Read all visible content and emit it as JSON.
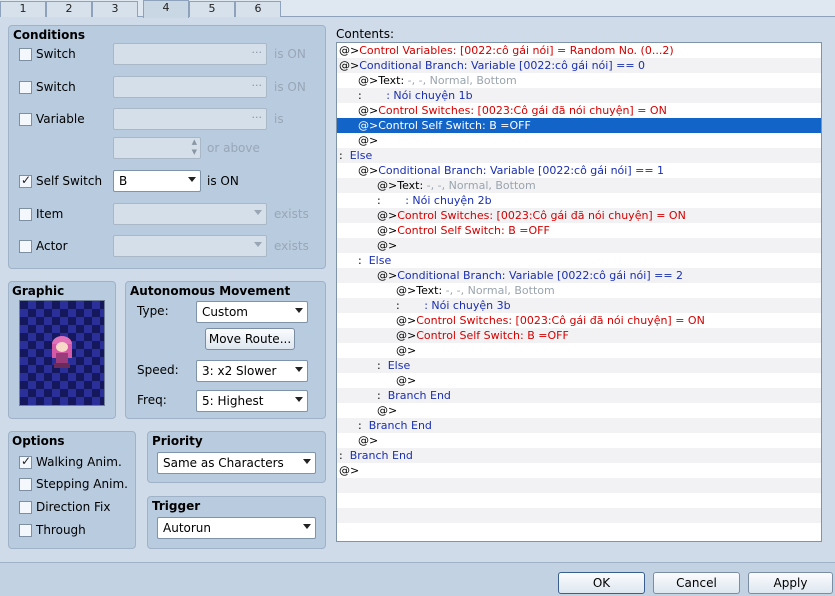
{
  "tabs": [
    "1",
    "2",
    "3",
    "4",
    "5",
    "6"
  ],
  "active_tab": "4",
  "conditions": {
    "title": "Conditions",
    "switch1": {
      "label": "Switch",
      "value": "",
      "suffix": "is ON",
      "checked": false
    },
    "switch2": {
      "label": "Switch",
      "value": "",
      "suffix": "is ON",
      "checked": false
    },
    "variable": {
      "label": "Variable",
      "value": "",
      "suffix": "is",
      "checked": false
    },
    "variable_value": {
      "value": "",
      "suffix": "or above"
    },
    "self_switch": {
      "label": "Self Switch",
      "value": "B",
      "suffix": "is ON",
      "checked": true
    },
    "item": {
      "label": "Item",
      "value": "",
      "suffix": "exists",
      "checked": false
    },
    "actor": {
      "label": "Actor",
      "value": "",
      "suffix": "exists",
      "checked": false
    }
  },
  "graphic": {
    "title": "Graphic"
  },
  "autonomous": {
    "title": "Autonomous Movement",
    "type_label": "Type:",
    "type_value": "Custom",
    "move_route_button": "Move Route...",
    "speed_label": "Speed:",
    "speed_value": "3: x2 Slower",
    "freq_label": "Freq:",
    "freq_value": "5: Highest"
  },
  "options": {
    "title": "Options",
    "walking": {
      "label": "Walking Anim.",
      "checked": true
    },
    "stepping": {
      "label": "Stepping Anim.",
      "checked": false
    },
    "direction_fix": {
      "label": "Direction Fix",
      "checked": false
    },
    "through": {
      "label": "Through",
      "checked": false
    }
  },
  "priority": {
    "title": "Priority",
    "value": "Same as Characters"
  },
  "trigger": {
    "title": "Trigger",
    "value": "Autorun"
  },
  "contents": {
    "label": "Contents:",
    "lines": [
      {
        "prefix": "@>",
        "text": "Control Variables: [0022:cô gái nói] = Random No. (0...2)",
        "color": "red",
        "indent": 0
      },
      {
        "prefix": "@>",
        "text": "Conditional Branch: Variable [0022:cô gái nói] == 0",
        "color": "blue",
        "indent": 0
      },
      {
        "prefix": "@>",
        "text": "Text: ",
        "extra": "-, -, Normal, Bottom",
        "color": "black",
        "indent": 1
      },
      {
        "prefix": " :",
        "text": "       : Nói chuyện 1b",
        "color": "blue",
        "indent": 1
      },
      {
        "prefix": "@>",
        "text": "Control Switches: [0023:Cô gái đã nói chuyện] = ON",
        "color": "red",
        "indent": 1
      },
      {
        "prefix": "@>",
        "text": "Control Self Switch: B =OFF",
        "color": "red",
        "indent": 1,
        "selected": true
      },
      {
        "prefix": "@>",
        "text": "",
        "color": "black",
        "indent": 1
      },
      {
        "prefix": " :",
        "text": "  Else",
        "color": "blue",
        "indent": 0
      },
      {
        "prefix": "@>",
        "text": "Conditional Branch: Variable [0022:cô gái nói] == 1",
        "color": "blue",
        "indent": 1
      },
      {
        "prefix": "@>",
        "text": "Text: ",
        "extra": "-, -, Normal, Bottom",
        "color": "black",
        "indent": 2
      },
      {
        "prefix": " :",
        "text": "       : Nói chuyện 2b",
        "color": "blue",
        "indent": 2
      },
      {
        "prefix": "@>",
        "text": "Control Switches: [0023:Cô gái đã nói chuyện] = ON",
        "color": "red",
        "indent": 2
      },
      {
        "prefix": "@>",
        "text": "Control Self Switch: B =OFF",
        "color": "red",
        "indent": 2
      },
      {
        "prefix": "@>",
        "text": "",
        "color": "black",
        "indent": 2
      },
      {
        "prefix": " :",
        "text": "  Else",
        "color": "blue",
        "indent": 1
      },
      {
        "prefix": "@>",
        "text": "Conditional Branch: Variable [0022:cô gái nói] == 2",
        "color": "blue",
        "indent": 2
      },
      {
        "prefix": "@>",
        "text": "Text: ",
        "extra": "-, -, Normal, Bottom",
        "color": "black",
        "indent": 3
      },
      {
        "prefix": " :",
        "text": "       : Nói chuyện 3b",
        "color": "blue",
        "indent": 3
      },
      {
        "prefix": "@>",
        "text": "Control Switches: [0023:Cô gái đã nói chuyện] = ON",
        "color": "red",
        "indent": 3
      },
      {
        "prefix": "@>",
        "text": "Control Self Switch: B =OFF",
        "color": "red",
        "indent": 3
      },
      {
        "prefix": "@>",
        "text": "",
        "color": "black",
        "indent": 3
      },
      {
        "prefix": " :",
        "text": "  Else",
        "color": "blue",
        "indent": 2
      },
      {
        "prefix": "@>",
        "text": "",
        "color": "black",
        "indent": 3
      },
      {
        "prefix": " :",
        "text": "  Branch End",
        "color": "blue",
        "indent": 2
      },
      {
        "prefix": "@>",
        "text": "",
        "color": "black",
        "indent": 2
      },
      {
        "prefix": " :",
        "text": "  Branch End",
        "color": "blue",
        "indent": 1
      },
      {
        "prefix": "@>",
        "text": "",
        "color": "black",
        "indent": 1
      },
      {
        "prefix": " :",
        "text": "  Branch End",
        "color": "blue",
        "indent": 0
      },
      {
        "prefix": "@>",
        "text": "",
        "color": "black",
        "indent": 0
      }
    ]
  },
  "buttons": {
    "ok": "OK",
    "cancel": "Cancel",
    "apply": "Apply"
  }
}
